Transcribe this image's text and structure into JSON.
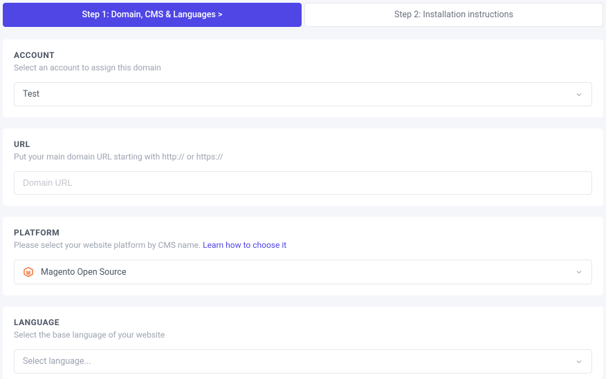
{
  "steps": {
    "active": "Step 1: Domain, CMS & Languages  >",
    "inactive": "Step 2: Installation instructions"
  },
  "account": {
    "title": "ACCOUNT",
    "subtitle": "Select an account to assign this domain",
    "value": "Test"
  },
  "url": {
    "title": "URL",
    "subtitle": "Put your main domain URL starting with http:// or https://",
    "placeholder": "Domain URL",
    "value": ""
  },
  "platform": {
    "title": "PLATFORM",
    "subtitle_pre": "Please select your website platform by CMS name.  ",
    "subtitle_link": "Learn how to choose it",
    "value": "Magento Open Source",
    "icon": "magento-icon"
  },
  "language": {
    "title": "LANGUAGE",
    "subtitle": "Select the base language of your website",
    "placeholder": "Select language..."
  }
}
